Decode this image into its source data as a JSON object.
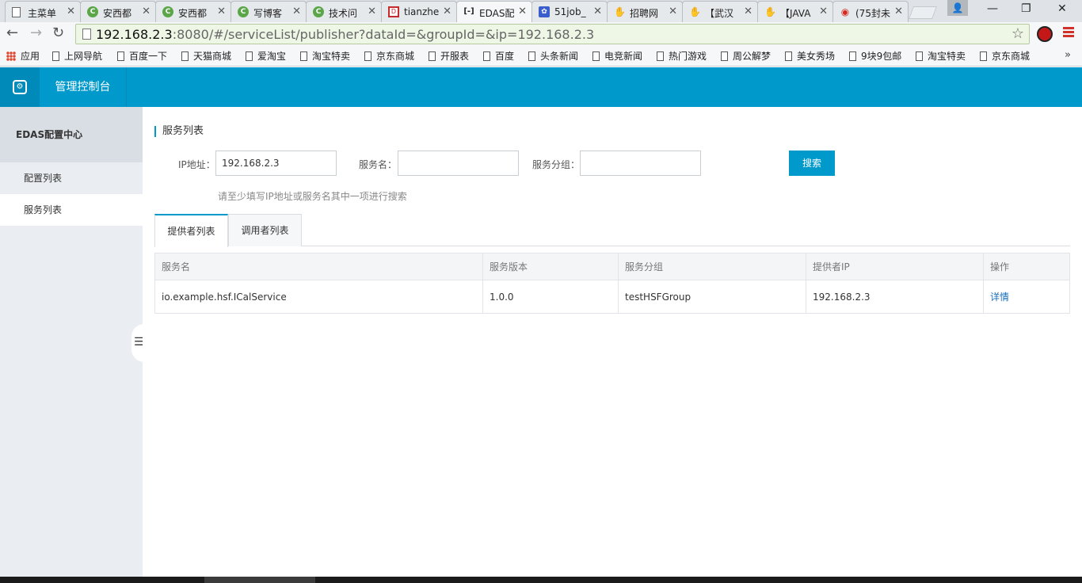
{
  "browser": {
    "tabs": [
      {
        "title": "主菜单",
        "icon": "page"
      },
      {
        "title": "安西都",
        "icon": "green-c"
      },
      {
        "title": "安西都",
        "icon": "green-c"
      },
      {
        "title": "写博客",
        "icon": "green-c"
      },
      {
        "title": "技术问",
        "icon": "green-c"
      },
      {
        "title": "tianzhe",
        "icon": "red-square"
      },
      {
        "title": "EDAS配",
        "icon": "edas"
      },
      {
        "title": "51job_",
        "icon": "paw"
      },
      {
        "title": "招聘网",
        "icon": "hand"
      },
      {
        "title": "【武汉",
        "icon": "hand"
      },
      {
        "title": "【JAVA",
        "icon": "hand"
      },
      {
        "title": "(75封未",
        "icon": "weibo"
      }
    ],
    "url_host": "192.168.2.3",
    "url_rest": ":8080/#/serviceList/publisher?dataId=&groupId=&ip=192.168.2.3",
    "bookmarks": [
      "应用",
      "上网导航",
      "百度一下",
      "天猫商城",
      "爱淘宝",
      "淘宝特卖",
      "京东商城",
      "开服表",
      "百度",
      "头条新闻",
      "电竞新闻",
      "热门游戏",
      "周公解梦",
      "美女秀场",
      "9块9包邮",
      "淘宝特卖",
      "京东商城"
    ],
    "bookmarks_more": "»"
  },
  "header": {
    "console_title": "管理控制台"
  },
  "sidebar": {
    "title": "EDAS配置中心",
    "items": [
      {
        "label": "配置列表"
      },
      {
        "label": "服务列表"
      }
    ]
  },
  "main": {
    "section_title": "服务列表",
    "form": {
      "ip_label": "IP地址：",
      "ip_value": "192.168.2.3",
      "service_label": "服务名：",
      "service_value": "",
      "group_label": "服务分组：",
      "group_value": "",
      "search_button": "搜索",
      "hint": "请至少填写IP地址或服务名其中一项进行搜索"
    },
    "tabs": [
      {
        "label": "提供者列表"
      },
      {
        "label": "调用者列表"
      }
    ],
    "table": {
      "headers": [
        "服务名",
        "服务版本",
        "服务分组",
        "提供者IP",
        "操作"
      ],
      "rows": [
        {
          "service": "io.example.hsf.ICalService",
          "version": "1.0.0",
          "group": "testHSFGroup",
          "ip": "192.168.2.3",
          "action": "详情"
        }
      ]
    }
  },
  "colors": {
    "brand": "#0099cc",
    "link": "#1a6fb9",
    "sidebar_bg": "#eaedf1"
  }
}
